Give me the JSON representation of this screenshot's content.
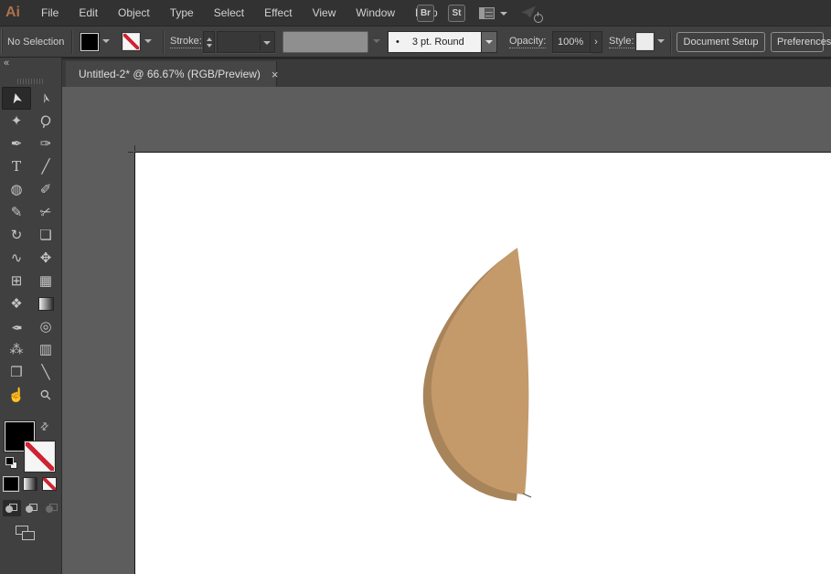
{
  "menu_bar": {
    "logo": "Ai",
    "items": [
      "File",
      "Edit",
      "Object",
      "Type",
      "Select",
      "Effect",
      "View",
      "Window",
      "Help"
    ],
    "bridge_label": "Br",
    "stock_label": "St"
  },
  "control_bar": {
    "no_selection_label": "No Selection",
    "stroke_label": "Stroke:",
    "brush_bullet": "•",
    "brush_value": "3 pt. Round",
    "opacity_label": "Opacity:",
    "opacity_value": "100%",
    "more_options_glyph": "›",
    "style_label": "Style:",
    "document_setup_label": "Document Setup",
    "preferences_label": "Preferences"
  },
  "tab": {
    "title": "Untitled-2* @ 66.67% (RGB/Preview)",
    "close_glyph": "×"
  },
  "toolbar": {
    "collapse_glyph": "«",
    "tools": [
      {
        "name": "selection-tool",
        "glyph": "➤",
        "rot": -105,
        "active": true
      },
      {
        "name": "direct-selection-tool",
        "glyph": "➢",
        "rot": -105
      },
      {
        "name": "magic-wand-tool",
        "glyph": "✦"
      },
      {
        "name": "lasso-tool",
        "glyph": "Ϙ",
        "rot": 18
      },
      {
        "name": "pen-tool",
        "glyph": "✒"
      },
      {
        "name": "curvature-tool",
        "glyph": "✑"
      },
      {
        "name": "type-tool",
        "glyph": "T",
        "serif": true
      },
      {
        "name": "line-segment-tool",
        "glyph": "╱"
      },
      {
        "name": "ellipse-tool",
        "glyph": "◍"
      },
      {
        "name": "paintbrush-tool",
        "glyph": "✐"
      },
      {
        "name": "shaper-tool",
        "glyph": "✎"
      },
      {
        "name": "scissors-tool",
        "glyph": "✂",
        "rot": -20
      },
      {
        "name": "rotate-tool",
        "glyph": "↻"
      },
      {
        "name": "scale-tool",
        "glyph": "❏"
      },
      {
        "name": "width-tool",
        "glyph": "∿"
      },
      {
        "name": "free-transform-tool",
        "glyph": "✥"
      },
      {
        "name": "shape-builder-tool",
        "glyph": "⊞"
      },
      {
        "name": "perspective-grid-tool",
        "glyph": "▦"
      },
      {
        "name": "mesh-tool",
        "glyph": "❖"
      },
      {
        "name": "gradient-tool",
        "shape": "gradient"
      },
      {
        "name": "eyedropper-tool",
        "glyph": "✒",
        "rot": 180
      },
      {
        "name": "blend-tool",
        "glyph": "◎"
      },
      {
        "name": "symbol-sprayer-tool",
        "glyph": "⁂"
      },
      {
        "name": "column-graph-tool",
        "glyph": "▥"
      },
      {
        "name": "artboard-tool",
        "glyph": "❒"
      },
      {
        "name": "slice-tool",
        "glyph": "╲"
      },
      {
        "name": "hand-tool",
        "glyph": "☝"
      },
      {
        "name": "zoom-tool",
        "glyph": "⚲",
        "rot": -45
      }
    ]
  },
  "swap_glyph": "⇄",
  "colors": {
    "menu_bg": "#323232",
    "control_bg": "#414141",
    "panel_bg": "#404040",
    "pasteboard": "#5d5d5d",
    "artboard": "#ffffff",
    "accent_red": "#cf2332",
    "logo_orange": "#b0714a",
    "fill_current": "#000000"
  },
  "artwork": {
    "body_color": "#c49a6b",
    "shadow_color": "#a8845b"
  }
}
